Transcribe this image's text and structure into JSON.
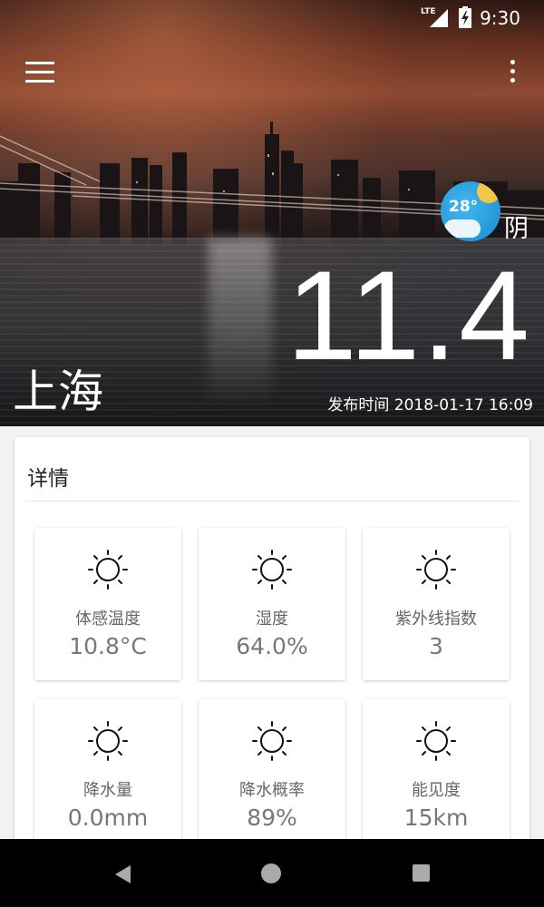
{
  "status_bar": {
    "network": "LTE",
    "time": "9:30"
  },
  "hero": {
    "weather_badge_temp": "28°",
    "weather_condition": "阴",
    "current_temp": "11.4",
    "city": "上海",
    "publish_time": "发布时间 2018-01-17 16:09"
  },
  "details": {
    "title": "详情",
    "items": [
      {
        "icon": "sun-icon",
        "label": "体感温度",
        "value": "10.8°C"
      },
      {
        "icon": "sun-icon",
        "label": "湿度",
        "value": "64.0%"
      },
      {
        "icon": "sun-icon",
        "label": "紫外线指数",
        "value": "3"
      },
      {
        "icon": "sun-icon",
        "label": "降水量",
        "value": "0.0mm"
      },
      {
        "icon": "sun-icon",
        "label": "降水概率",
        "value": "89%"
      },
      {
        "icon": "sun-icon",
        "label": "能见度",
        "value": "15km"
      }
    ]
  },
  "colors": {
    "badge_blue": "#2598d8",
    "badge_sun": "#f6c64a",
    "text_muted": "#777777"
  }
}
